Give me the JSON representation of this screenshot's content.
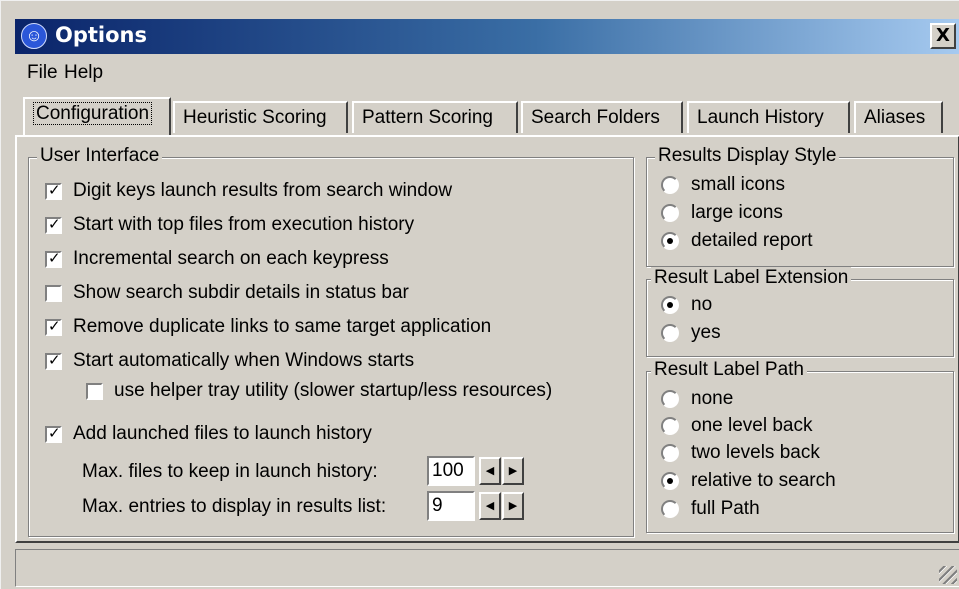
{
  "window": {
    "title": "Options",
    "close_label": "X",
    "icon": "app-running-man-icon"
  },
  "menu": {
    "items": [
      "File",
      "Help"
    ]
  },
  "tabs": [
    "Configuration",
    "Heuristic Scoring",
    "Pattern Scoring",
    "Search Folders",
    "Launch History",
    "Aliases"
  ],
  "active_tab": "Configuration",
  "user_interface": {
    "title": "User Interface",
    "options": [
      {
        "label": "Digit keys launch results from search window",
        "checked": true
      },
      {
        "label": "Start with top files from execution history",
        "checked": true
      },
      {
        "label": "Incremental search on each keypress",
        "checked": true
      },
      {
        "label": "Show search subdir details in status bar",
        "checked": false
      },
      {
        "label": "Remove duplicate links to same target application",
        "checked": true
      },
      {
        "label": "Start automatically when Windows starts",
        "checked": true
      },
      {
        "label": "use helper tray utility (slower startup/less resources)",
        "checked": false
      },
      {
        "label": "Add launched files to launch history",
        "checked": true
      }
    ],
    "max_files_label": "Max. files to keep in launch history:",
    "max_files_value": "100",
    "max_entries_label": "Max. entries to display in results list:",
    "max_entries_value": "9"
  },
  "results_display_style": {
    "title": "Results Display Style",
    "options": [
      "small icons",
      "large icons",
      "detailed report"
    ],
    "selected": "detailed report"
  },
  "result_label_extension": {
    "title": "Result Label Extension",
    "options": [
      "no",
      "yes"
    ],
    "selected": "no"
  },
  "result_label_path": {
    "title": "Result Label Path",
    "options": [
      "none",
      "one level back",
      "two levels back",
      "relative to search",
      "full Path"
    ],
    "selected": "relative to search"
  },
  "check_mark": "✓",
  "spin_left": "◀",
  "spin_right": "▶"
}
